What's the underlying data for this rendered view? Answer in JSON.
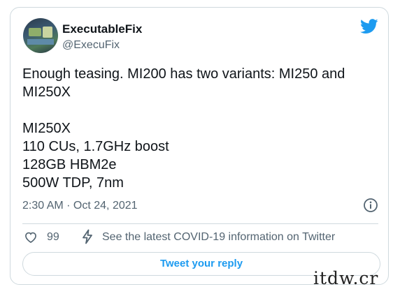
{
  "tweet": {
    "author_name": "ExecutableFix",
    "author_handle": "@ExecuFix",
    "text": "Enough teasing. MI200 has two variants: MI250 and MI250X\n\nMI250X\n110 CUs, 1.7GHz boost\n128GB HBM2e\n500W TDP, 7nm",
    "timestamp": "2:30 AM · Oct 24, 2021",
    "like_count": "99",
    "covid_link": "See the latest COVID-19 information on Twitter",
    "reply_label": "Tweet your reply"
  },
  "icons": {
    "brand": "twitter-bird-icon",
    "info": "info-icon",
    "like": "heart-icon",
    "covid": "lightning-bolt-icon"
  },
  "colors": {
    "brand_blue": "#1d9bf0",
    "text_primary": "#0f1419",
    "text_secondary": "#536471",
    "border": "#cfd9de"
  },
  "watermark": "itdw.cr"
}
